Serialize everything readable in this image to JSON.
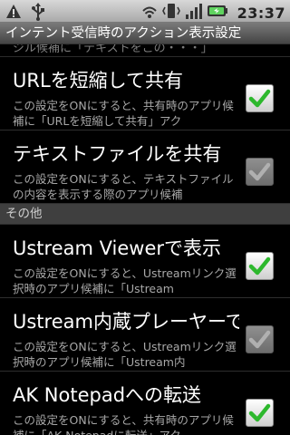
{
  "status_bar": {
    "icons": [
      "warning-icon",
      "usb-icon",
      "wifi-icon",
      "vibrate-icon",
      "signal-icon",
      "battery-icon"
    ],
    "time": "23:37"
  },
  "title_bar": {
    "title": "インテント受信時のアクション表示設定"
  },
  "cutoff_text": "ジル候補に「テキストをこの・・・」",
  "sections": [
    {
      "items": [
        {
          "title": "URLを短縮して共有",
          "summary": "この設定をONにすると、共有時のアプリ候補に「URLを短縮して共有」アク",
          "checked": true,
          "enabled": true
        },
        {
          "title": "テキストファイルを共有",
          "summary": "この設定をONにすると、テキストファイルの内容を表示する際のアプリ候補",
          "checked": true,
          "enabled": false
        }
      ]
    },
    {
      "header": "その他",
      "items": [
        {
          "title": "Ustream Viewerで表示",
          "summary": "この設定をONにすると、Ustreamリンク選択時のアプリ候補に「Ustream",
          "checked": true,
          "enabled": true
        },
        {
          "title": "Ustream内蔵プレーヤーで",
          "summary": "この設定をONにすると、Ustreamリンク選択時のアプリ候補に「Ustream内",
          "checked": true,
          "enabled": false
        },
        {
          "title": "AK Notepadへの転送",
          "summary": "この設定をONにすると、共有時のアプリ候補に「AK Notepadに転送」アク",
          "checked": true,
          "enabled": true
        }
      ]
    }
  ],
  "colors": {
    "check_enabled": "#2db82d",
    "check_disabled": "#b0b0b0",
    "background": "#000000",
    "category_bg": "#3f3f3f"
  }
}
